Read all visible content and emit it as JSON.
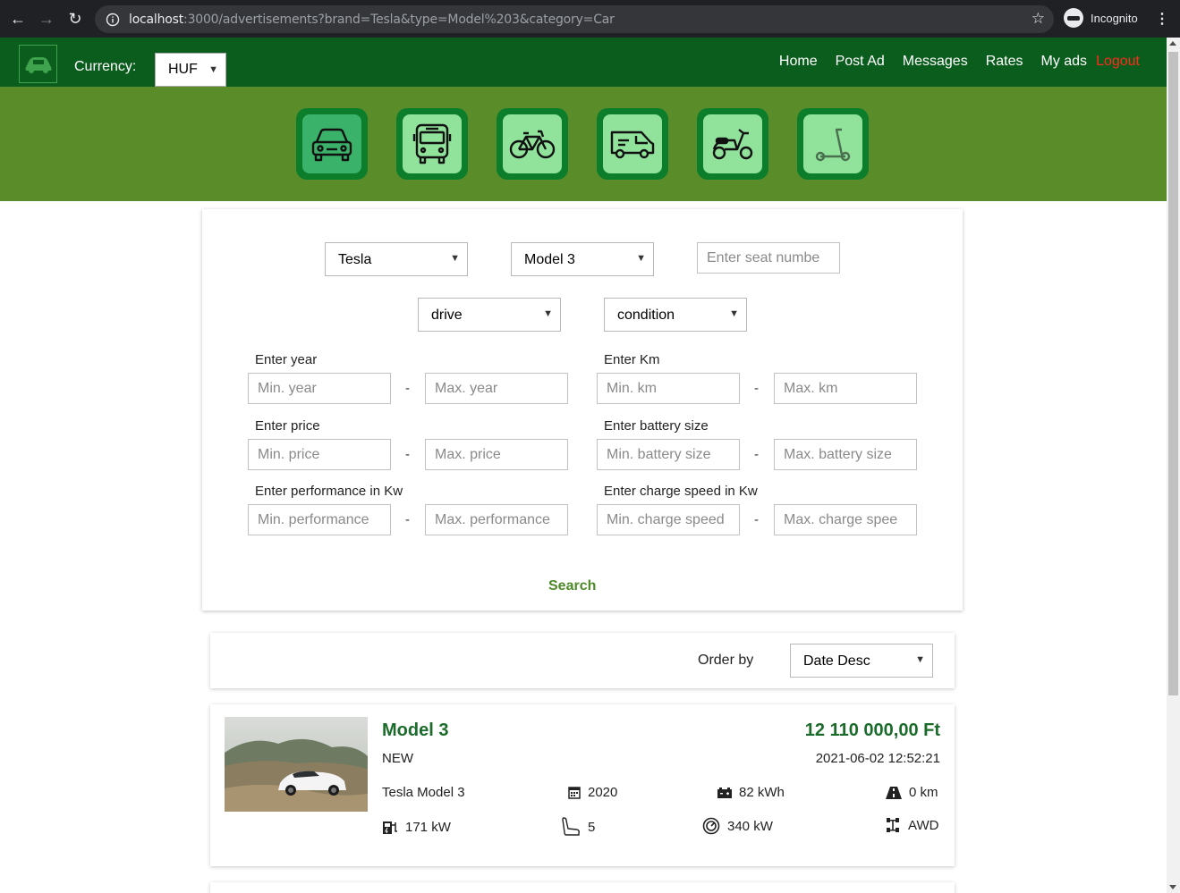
{
  "browser": {
    "url_host": "localhost",
    "url_rest": ":3000/advertisements?brand=Tesla&type=Model%203&category=Car",
    "profile_label": "Incognito"
  },
  "header": {
    "currency_label": "Currency:",
    "currency_value": "HUF",
    "menu": [
      "Home",
      "Post Ad",
      "Messages",
      "Rates",
      "My ads"
    ],
    "logout": "Logout"
  },
  "categories": [
    {
      "name": "car-icon",
      "active": true
    },
    {
      "name": "bus-icon",
      "active": false
    },
    {
      "name": "bicycle-icon",
      "active": false
    },
    {
      "name": "van-icon",
      "active": false
    },
    {
      "name": "scooter-icon",
      "active": false
    },
    {
      "name": "kick-scooter-icon",
      "active": false
    }
  ],
  "filters": {
    "brand": "Tesla",
    "model": "Model 3",
    "seat_placeholder": "Enter seat numbe",
    "drive": "drive",
    "condition": "condition",
    "year_label": "Enter year",
    "year_min": "Min. year",
    "year_max": "Max. year",
    "km_label": "Enter Km",
    "km_min": "Min. km",
    "km_max": "Max. km",
    "price_label": "Enter price",
    "price_min": "Min. price",
    "price_max": "Max. price",
    "battery_label": "Enter battery size",
    "battery_min": "Min. battery size",
    "battery_max": "Max. battery size",
    "perf_label": "Enter performance in Kw",
    "perf_min": "Min. performance",
    "perf_max": "Max. performance",
    "charge_label": "Enter charge speed in Kw",
    "charge_min": "Min. charge speed",
    "charge_max": "Max. charge spee",
    "dash": "-",
    "search": "Search"
  },
  "order": {
    "label": "Order by",
    "value": "Date Desc"
  },
  "ad": {
    "title": "Model 3",
    "price": "12 110 000,00 Ft",
    "condition": "NEW",
    "date": "2021-06-02 12:52:21",
    "name": "Tesla Model 3",
    "year": "2020",
    "battery": "82 kWh",
    "km": "0 km",
    "charge": "171 kW",
    "seats": "5",
    "performance": "340 kW",
    "drive": "AWD"
  }
}
